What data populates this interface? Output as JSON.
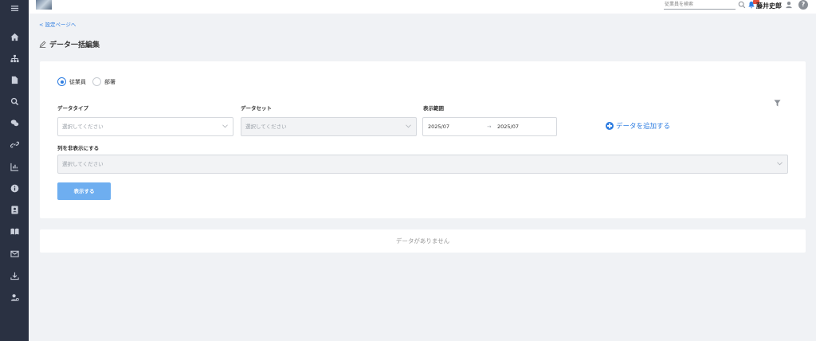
{
  "topbar": {
    "search_placeholder": "従業員を検索",
    "user_name": "藤井史郎",
    "help_label": "?"
  },
  "nav": {
    "back_link": "< 設定ページへ",
    "page_title": "データ一括編集"
  },
  "sidebar": {
    "items": [
      "menu-icon",
      "home-icon",
      "org-chart-icon",
      "document-icon",
      "search-icon",
      "chat-icon",
      "link-icon",
      "chart-icon",
      "info-icon",
      "contacts-icon",
      "book-icon",
      "mail-icon",
      "download-icon",
      "user-settings-icon"
    ]
  },
  "form": {
    "radio_employee": "従業員",
    "radio_department": "部署",
    "selected_radio": "従業員",
    "data_type_label": "データタイプ",
    "data_type_placeholder": "選択してください",
    "data_set_label": "データセット",
    "data_set_placeholder": "選択してください",
    "display_range_label": "表示範囲",
    "range_start": "2025/07",
    "range_arrow": "→",
    "range_end": "2025/07",
    "add_data_label": "データを追加する",
    "hide_columns_label": "列を非表示にする",
    "hide_columns_placeholder": "選択してください",
    "show_button": "表示する"
  },
  "results": {
    "empty_message": "データがありません"
  },
  "colors": {
    "sidebar_bg": "#2a3142",
    "accent": "#2e7de1",
    "button": "#6eaef0",
    "page_bg": "#f0f2f5"
  }
}
